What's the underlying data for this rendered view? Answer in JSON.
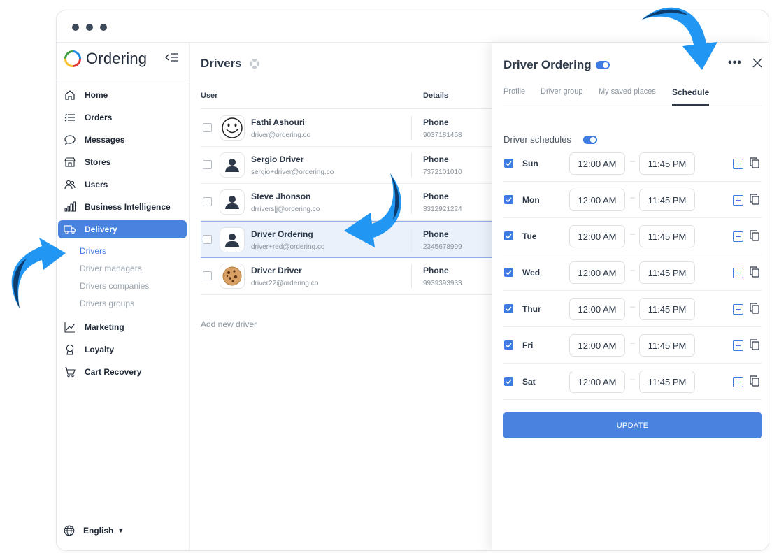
{
  "sidebar": {
    "brand": "Ordering",
    "nav": [
      {
        "label": "Home",
        "icon": "home-icon"
      },
      {
        "label": "Orders",
        "icon": "list-icon"
      },
      {
        "label": "Messages",
        "icon": "chat-icon"
      },
      {
        "label": "Stores",
        "icon": "store-icon"
      },
      {
        "label": "Users",
        "icon": "users-icon"
      },
      {
        "label": "Business Intelligence",
        "icon": "bar-chart-icon"
      },
      {
        "label": "Delivery",
        "icon": "truck-icon"
      },
      {
        "label": "Marketing",
        "icon": "trend-icon"
      },
      {
        "label": "Loyalty",
        "icon": "award-icon"
      },
      {
        "label": "Cart Recovery",
        "icon": "cart-icon"
      }
    ],
    "delivery_sub": [
      "Drivers",
      "Driver managers",
      "Drivers companies",
      "Drivers groups"
    ],
    "language": "English"
  },
  "main": {
    "title": "Drivers",
    "columns": {
      "user": "User",
      "details": "Details"
    },
    "drivers": [
      {
        "name": "Fathi Ashouri",
        "email": "driver@ordering.co",
        "detail_label": "Phone",
        "phone": "9037181458"
      },
      {
        "name": "Sergio Driver",
        "email": "sergio+driver@ordering.co",
        "detail_label": "Phone",
        "phone": "7372101010"
      },
      {
        "name": "Steve Jhonson",
        "email": "drrivers|j@ordering.co",
        "detail_label": "Phone",
        "phone": "3312921224"
      },
      {
        "name": "Driver Ordering",
        "email": "driver+red@ordering.co",
        "detail_label": "Phone",
        "phone": "2345678999"
      },
      {
        "name": "Driver Driver",
        "email": "driver22@ordering.co",
        "detail_label": "Phone",
        "phone": "9939393933"
      }
    ],
    "add_driver": "Add new driver"
  },
  "panel": {
    "title": "Driver Ordering",
    "tabs": [
      "Profile",
      "Driver group",
      "My saved places",
      "Schedule"
    ],
    "active_tab": "Schedule",
    "schedules_label": "Driver schedules",
    "days": [
      {
        "day": "Sun",
        "start": "12:00 AM",
        "end": "11:45 PM"
      },
      {
        "day": "Mon",
        "start": "12:00 AM",
        "end": "11:45 PM"
      },
      {
        "day": "Tue",
        "start": "12:00 AM",
        "end": "11:45 PM"
      },
      {
        "day": "Wed",
        "start": "12:00 AM",
        "end": "11:45 PM"
      },
      {
        "day": "Thur",
        "start": "12:00 AM",
        "end": "11:45 PM"
      },
      {
        "day": "Fri",
        "start": "12:00 AM",
        "end": "11:45 PM"
      },
      {
        "day": "Sat",
        "start": "12:00 AM",
        "end": "11:45 PM"
      }
    ],
    "update_label": "UPDATE"
  },
  "colors": {
    "accent": "#4a82e0",
    "arrow_light": "#2196f3",
    "arrow_dark": "#0d3d6e"
  }
}
